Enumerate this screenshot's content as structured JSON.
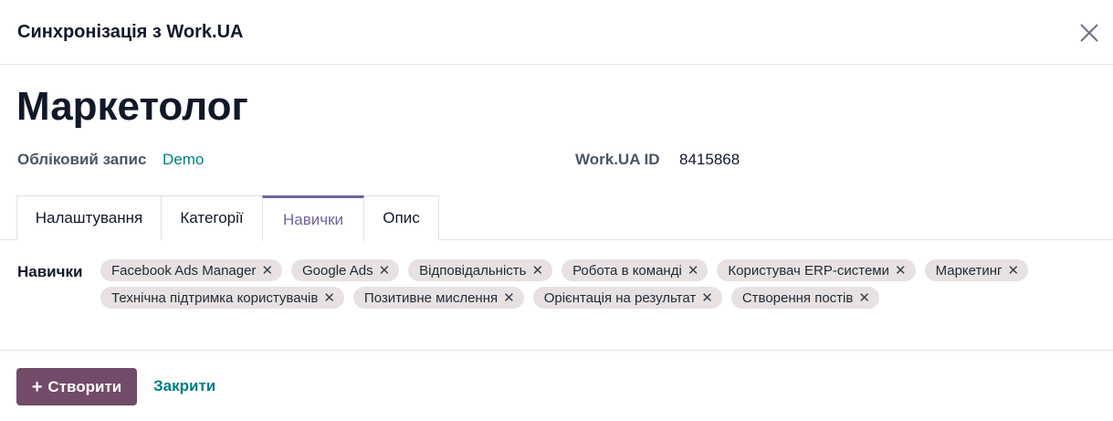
{
  "dialog": {
    "title": "Синхронізація з Work.UA"
  },
  "record": {
    "name": "Маркетолог",
    "account_label": "Обліковий запис",
    "account_value": "Demo",
    "workua_id_label": "Work.UA ID",
    "workua_id_value": "8415868"
  },
  "tabs": [
    {
      "label": "Налаштування",
      "active": false
    },
    {
      "label": "Категорії",
      "active": false
    },
    {
      "label": "Навички",
      "active": true
    },
    {
      "label": "Опис",
      "active": false
    }
  ],
  "skills": {
    "label": "Навички",
    "row1": [
      "Facebook Ads Manager",
      "Google Ads",
      "Відповідальність",
      "Робота в команді",
      "Користувач ERP-системи",
      "Маркетинг"
    ],
    "row2": [
      "Технічна підтримка користувачів",
      "Позитивне мислення",
      "Орієнтація на результат",
      "Створення постів"
    ],
    "remove_glyph": "✕"
  },
  "footer": {
    "create_label": "Створити",
    "close_label": "Закрити"
  },
  "colors": {
    "primary": "#714b67",
    "link": "#017e84",
    "active_tab": "#71639e",
    "tag_bg": "#e7e2e1"
  },
  "icons": {
    "close": "close-icon",
    "plus": "plus-icon",
    "tag_remove": "remove-tag-icon"
  }
}
